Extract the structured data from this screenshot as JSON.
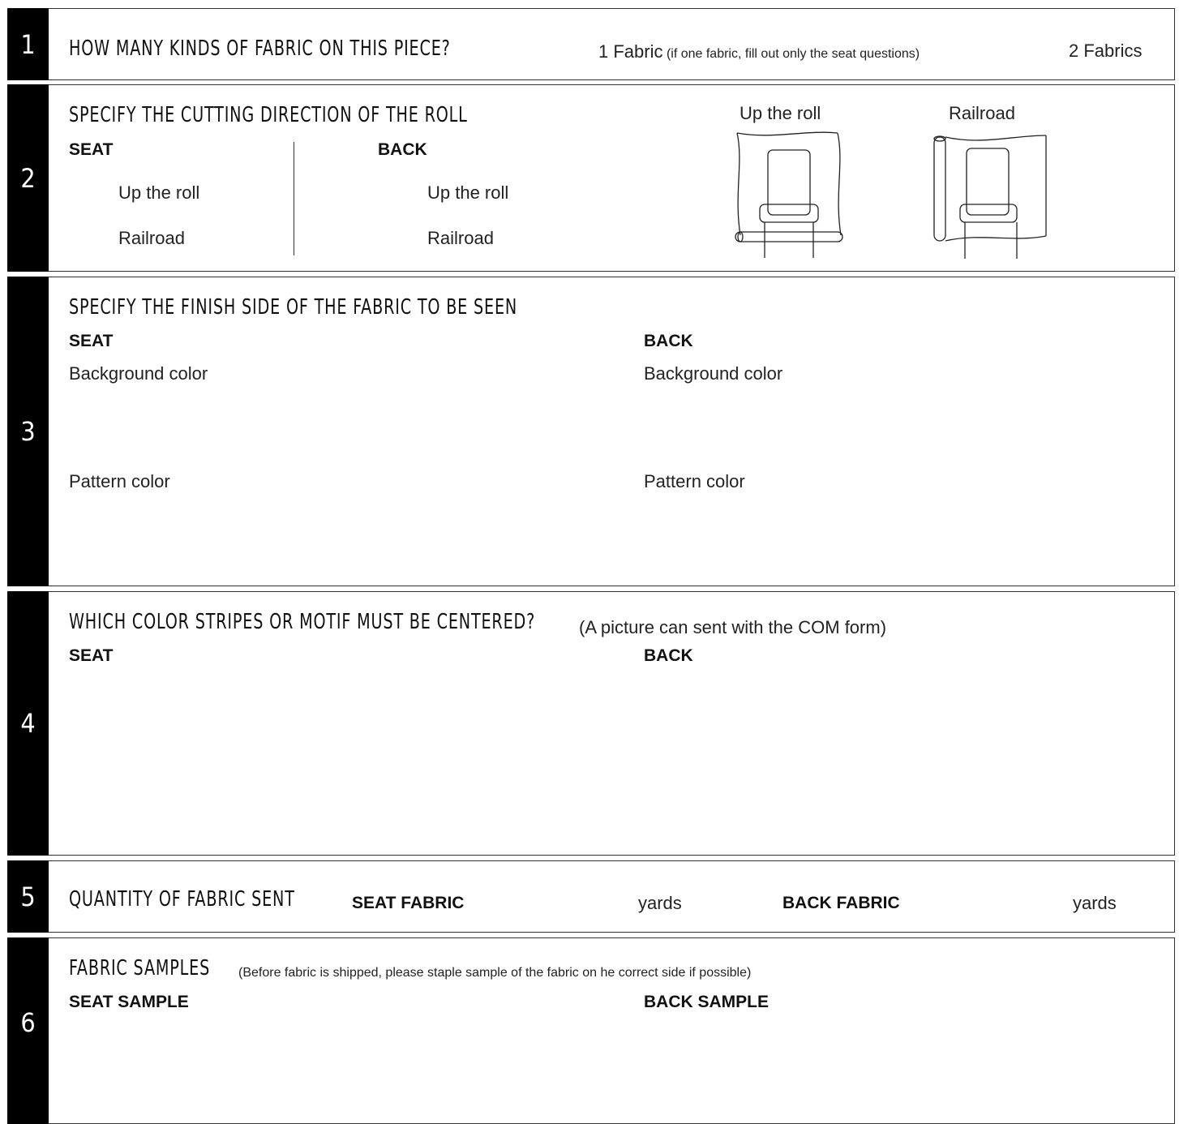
{
  "sections": [
    {
      "number": "1",
      "heading": "HOW MANY KINDS OF FABRIC ON THIS PIECE?",
      "option_one": "1 Fabric",
      "option_one_note": "(if one fabric, fill out only the seat questions)",
      "option_two": "2 Fabrics"
    },
    {
      "number": "2",
      "heading": "SPECIFY THE CUTTING DIRECTION OF THE ROLL",
      "seat_label": "SEAT",
      "back_label": "BACK",
      "seat_options": [
        "Up the roll",
        "Railroad"
      ],
      "back_options": [
        "Up the roll",
        "Railroad"
      ],
      "illustration_labels": [
        "Up the roll",
        "Railroad"
      ]
    },
    {
      "number": "3",
      "heading": "SPECIFY THE FINISH SIDE OF THE FABRIC TO BE SEEN",
      "seat_label": "SEAT",
      "back_label": "BACK",
      "seat_fields": [
        "Background color",
        "Pattern color"
      ],
      "back_fields": [
        "Background color",
        "Pattern color"
      ]
    },
    {
      "number": "4",
      "heading": "WHICH COLOR STRIPES OR MOTIF MUST BE CENTERED?",
      "heading_note": "(A picture can sent with the COM form)",
      "seat_label": "SEAT",
      "back_label": "BACK"
    },
    {
      "number": "5",
      "heading": "QUANTITY OF FABRIC SENT",
      "seat_label": "SEAT FABRIC",
      "seat_unit": "yards",
      "back_label": "BACK FABRIC",
      "back_unit": "yards"
    },
    {
      "number": "6",
      "heading": "FABRIC SAMPLES",
      "heading_note": "(Before fabric is shipped, please staple sample of the fabric on he correct side if possible)",
      "seat_label": "SEAT SAMPLE",
      "back_label": "BACK SAMPLE"
    }
  ],
  "colors": {
    "number_band": "#000000",
    "border": "#333333",
    "text": "#1a1a1a"
  },
  "icons": [
    "chair-on-roll-up-the-roll-illustration",
    "chair-on-roll-railroad-illustration"
  ]
}
